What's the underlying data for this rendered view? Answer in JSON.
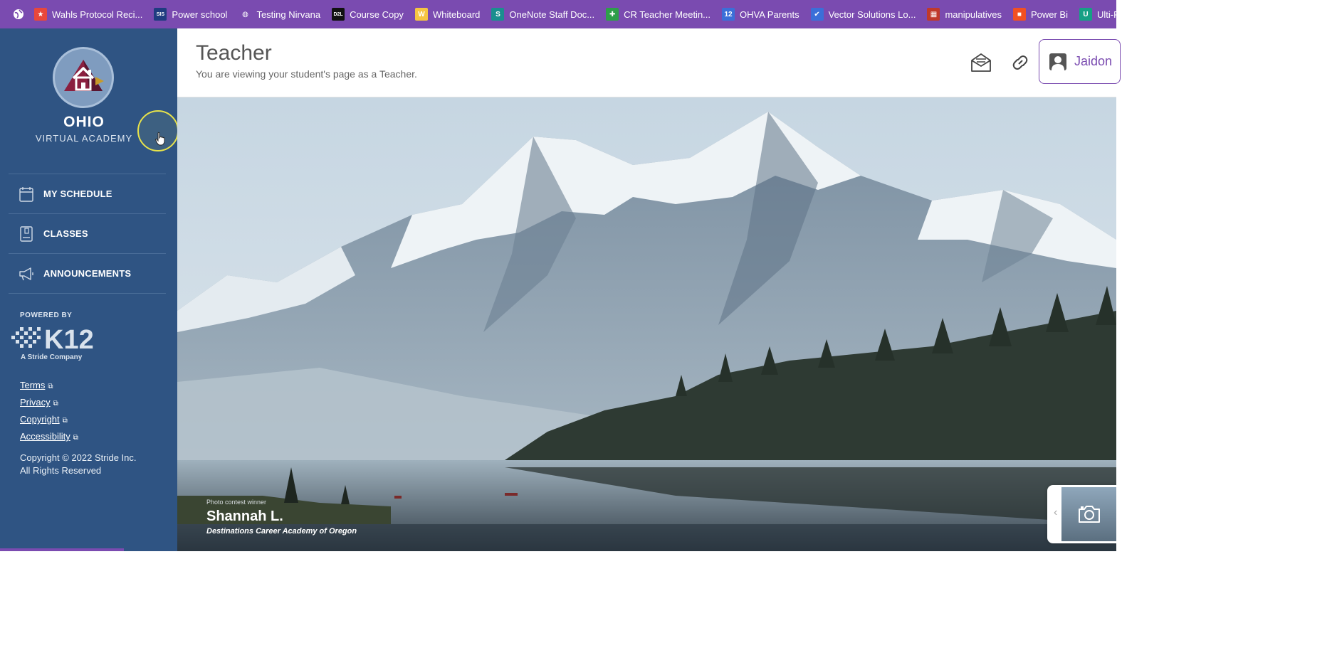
{
  "bookmarks": [
    {
      "label": "Wahls Protocol Reci...",
      "icon": "star-icon",
      "color": "#e8473b"
    },
    {
      "label": "Power school",
      "icon": "sis-icon",
      "color": "#1f3c80"
    },
    {
      "label": "Testing Nirvana",
      "icon": "globe-icon",
      "color": "#7a4bb0"
    },
    {
      "label": "Course Copy",
      "icon": "d2l-icon",
      "color": "#111111"
    },
    {
      "label": "Whiteboard",
      "icon": "w-icon",
      "color": "#f5c542"
    },
    {
      "label": "OneNote Staff Doc...",
      "icon": "sharepoint-icon",
      "color": "#1a8f8f"
    },
    {
      "label": "CR Teacher Meetin...",
      "icon": "plus-icon",
      "color": "#2e9e4a"
    },
    {
      "label": "OHVA Parents",
      "icon": "k12-icon",
      "color": "#3b6fd8"
    },
    {
      "label": "Vector Solutions Lo...",
      "icon": "check-icon",
      "color": "#3b6fd8"
    },
    {
      "label": "manipulatives",
      "icon": "grid-icon",
      "color": "#c0392b"
    },
    {
      "label": "Power Bi",
      "icon": "microsoft-icon",
      "color": "#f25022"
    },
    {
      "label": "Ulti-Pro",
      "icon": "u-icon",
      "color": "#16a085"
    }
  ],
  "sidebar": {
    "school_name": "OHIO",
    "school_sub": "VIRTUAL ACADEMY",
    "nav": [
      {
        "label": "MY SCHEDULE",
        "icon": "calendar-icon"
      },
      {
        "label": "CLASSES",
        "icon": "book-icon"
      },
      {
        "label": "ANNOUNCEMENTS",
        "icon": "megaphone-icon"
      }
    ],
    "powered_by": "POWERED BY",
    "k12_logo": "K12",
    "k12_tagline": "A Stride Company",
    "links": [
      "Terms",
      "Privacy",
      "Copyright",
      "Accessibility"
    ],
    "copyright_line1": "Copyright © 2022 Stride Inc.",
    "copyright_line2": "All Rights Reserved"
  },
  "header": {
    "title": "Teacher",
    "subtitle": "You are viewing your student's page as a Teacher.",
    "user_name": "Jaidon"
  },
  "hero": {
    "credit_label": "Photo contest winner",
    "credit_name": "Shannah L.",
    "credit_school": "Destinations Career Academy of Oregon"
  },
  "colors": {
    "bookmarks_bar": "#7a4bb0",
    "sidebar": "#2f5483",
    "accent": "#7a4bb0"
  }
}
